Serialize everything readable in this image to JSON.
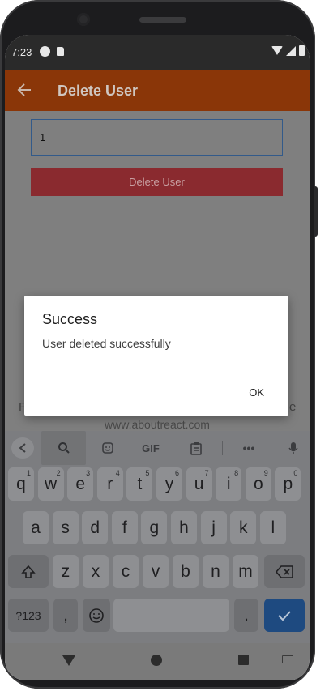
{
  "status_bar": {
    "time": "7:23"
  },
  "app_bar": {
    "title": "Delete User"
  },
  "form": {
    "user_id_value": "1",
    "delete_button_label": "Delete User"
  },
  "footer": {
    "left_fragment": "F",
    "right_fragment": "e",
    "site": "www.aboutreact.com"
  },
  "dialog": {
    "title": "Success",
    "message": "User deleted successfully",
    "ok_label": "OK"
  },
  "keyboard": {
    "suggestions": {
      "gif_label": "GIF",
      "more_label": "•••"
    },
    "row1": [
      {
        "key": "q",
        "hint": "1"
      },
      {
        "key": "w",
        "hint": "2"
      },
      {
        "key": "e",
        "hint": "3"
      },
      {
        "key": "r",
        "hint": "4"
      },
      {
        "key": "t",
        "hint": "5"
      },
      {
        "key": "y",
        "hint": "6"
      },
      {
        "key": "u",
        "hint": "7"
      },
      {
        "key": "i",
        "hint": "8"
      },
      {
        "key": "o",
        "hint": "9"
      },
      {
        "key": "p",
        "hint": "0"
      }
    ],
    "row2": [
      "a",
      "s",
      "d",
      "f",
      "g",
      "h",
      "j",
      "k",
      "l"
    ],
    "row3": [
      "z",
      "x",
      "c",
      "v",
      "b",
      "n",
      "m"
    ],
    "symbols_label": "?123",
    "comma_label": ",",
    "period_label": ".",
    "emoji_icon": "emoji-icon",
    "shift_icon": "shift-icon",
    "backspace_icon": "backspace-icon",
    "enter_icon": "checkmark-icon"
  },
  "colors": {
    "app_bar": "#8a3608",
    "delete_button": "#8a2a2f",
    "enter_key": "#1e4a80"
  }
}
